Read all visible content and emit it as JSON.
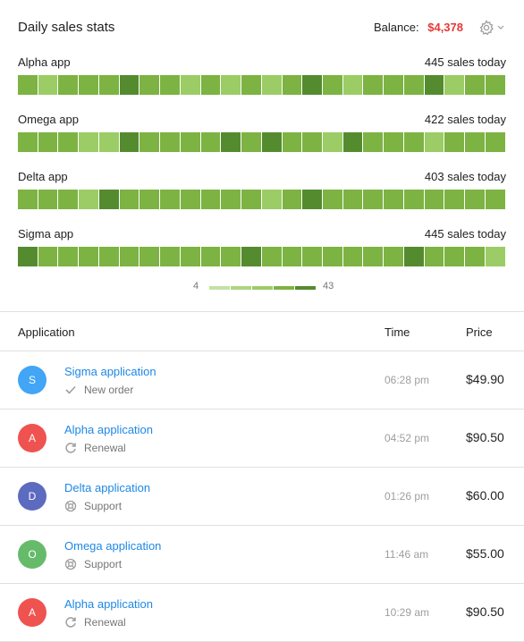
{
  "header": {
    "title": "Daily sales stats",
    "balance_label": "Balance:",
    "balance_value": "$4,378",
    "settings_icon": "gear-icon"
  },
  "colors": {
    "levels": [
      "#c5e1a5",
      "#aed581",
      "#9ccc65",
      "#7cb342",
      "#558b2f"
    ],
    "balance": "#e53935",
    "link": "#1e88e5"
  },
  "apps": [
    {
      "name": "Alpha app",
      "sales": "445 sales today",
      "levels": [
        3,
        2,
        3,
        3,
        3,
        4,
        3,
        3,
        2,
        3,
        2,
        3,
        2,
        3,
        4,
        3,
        2,
        3,
        3,
        3,
        4,
        2,
        3,
        3
      ]
    },
    {
      "name": "Omega app",
      "sales": "422 sales today",
      "levels": [
        3,
        3,
        3,
        2,
        2,
        4,
        3,
        3,
        3,
        3,
        4,
        3,
        4,
        3,
        3,
        2,
        4,
        3,
        3,
        3,
        2,
        3,
        3,
        3
      ]
    },
    {
      "name": "Delta app",
      "sales": "403 sales today",
      "levels": [
        3,
        3,
        3,
        2,
        4,
        3,
        3,
        3,
        3,
        3,
        3,
        3,
        2,
        3,
        4,
        3,
        3,
        3,
        3,
        3,
        3,
        3,
        3,
        3
      ]
    },
    {
      "name": "Sigma app",
      "sales": "445 sales today",
      "levels": [
        4,
        3,
        3,
        3,
        3,
        3,
        3,
        3,
        3,
        3,
        3,
        4,
        3,
        3,
        3,
        3,
        3,
        3,
        3,
        4,
        3,
        3,
        3,
        2
      ]
    }
  ],
  "scale": {
    "min": "4",
    "max": "43"
  },
  "table": {
    "headers": {
      "application": "Application",
      "time": "Time",
      "price": "Price"
    },
    "rows": [
      {
        "initial": "S",
        "avatar_color": "#42a5f5",
        "app": "Sigma application",
        "type": "New order",
        "type_icon": "check-icon",
        "time": "06:28 pm",
        "price": "$49.90"
      },
      {
        "initial": "A",
        "avatar_color": "#ef5350",
        "app": "Alpha application",
        "type": "Renewal",
        "type_icon": "refresh-icon",
        "time": "04:52 pm",
        "price": "$90.50"
      },
      {
        "initial": "D",
        "avatar_color": "#5c6bc0",
        "app": "Delta application",
        "type": "Support",
        "type_icon": "lifebuoy-icon",
        "time": "01:26 pm",
        "price": "$60.00"
      },
      {
        "initial": "O",
        "avatar_color": "#66bb6a",
        "app": "Omega application",
        "type": "Support",
        "type_icon": "lifebuoy-icon",
        "time": "11:46 am",
        "price": "$55.00"
      },
      {
        "initial": "A",
        "avatar_color": "#ef5350",
        "app": "Alpha application",
        "type": "Renewal",
        "type_icon": "refresh-icon",
        "time": "10:29 am",
        "price": "$90.50"
      }
    ]
  }
}
